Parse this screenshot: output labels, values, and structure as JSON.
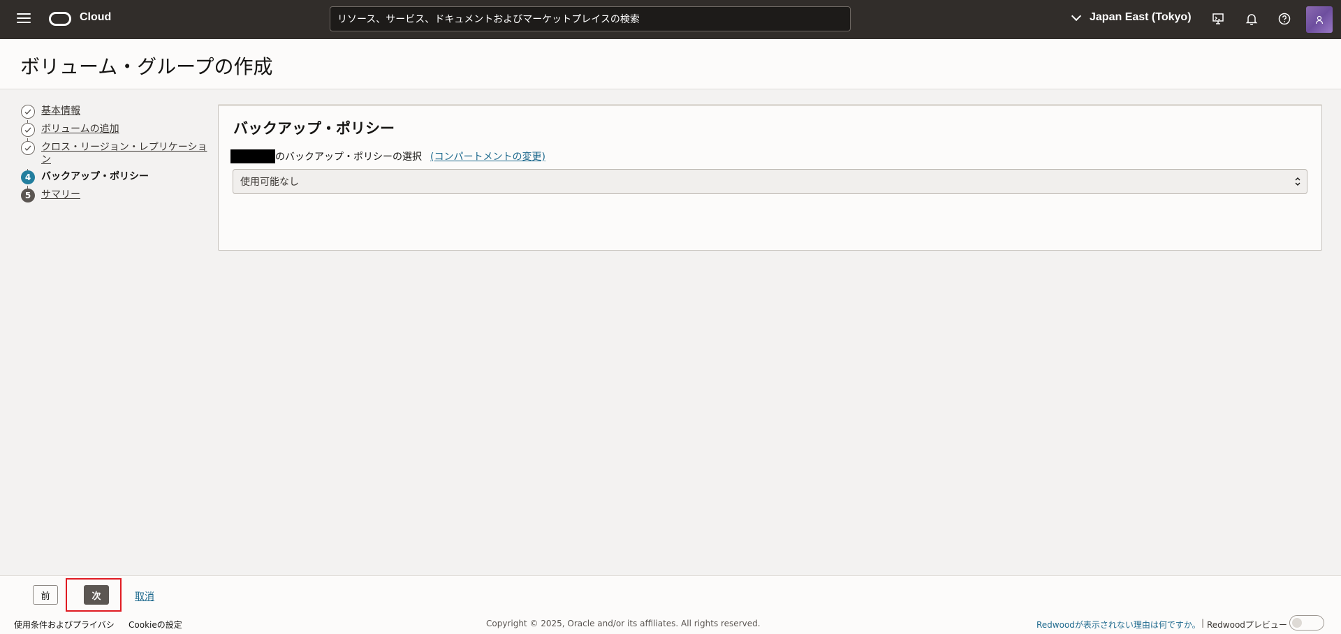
{
  "header": {
    "brand": "Cloud",
    "search_placeholder": "リソース、サービス、ドキュメントおよびマーケットプレイスの検索",
    "region": "Japan East (Tokyo)"
  },
  "page": {
    "title": "ボリューム・グループの作成"
  },
  "steps": [
    {
      "number": "1",
      "label": "基本情報",
      "state": "done"
    },
    {
      "number": "2",
      "label": "ボリュームの追加",
      "state": "done"
    },
    {
      "number": "3",
      "label": "クロス・リージョン・レプリケーション",
      "state": "done"
    },
    {
      "number": "4",
      "label": "バックアップ・ポリシー",
      "state": "current"
    },
    {
      "number": "5",
      "label": "サマリー",
      "state": "future"
    }
  ],
  "panel": {
    "title": "バックアップ・ポリシー",
    "select_label": "のバックアップ・ポリシーの選択",
    "change_compartment": "(コンパートメントの変更)",
    "select_value": "使用可能なし"
  },
  "actions": {
    "prev": "前",
    "next": "次",
    "cancel": "取消"
  },
  "footer": {
    "terms": "使用条件およびプライバシ",
    "cookies": "Cookieの設定",
    "copyright": "Copyright © 2025, Oracle and/or its affiliates. All rights reserved.",
    "why": "Redwoodが表示されない理由は何ですか。",
    "separator": "|",
    "preview": "Redwoodプレビュー"
  },
  "colors": {
    "header_bg": "#312d2a",
    "accent": "#227e9e",
    "link": "#1f6a8e",
    "highlight": "#e01b22"
  }
}
